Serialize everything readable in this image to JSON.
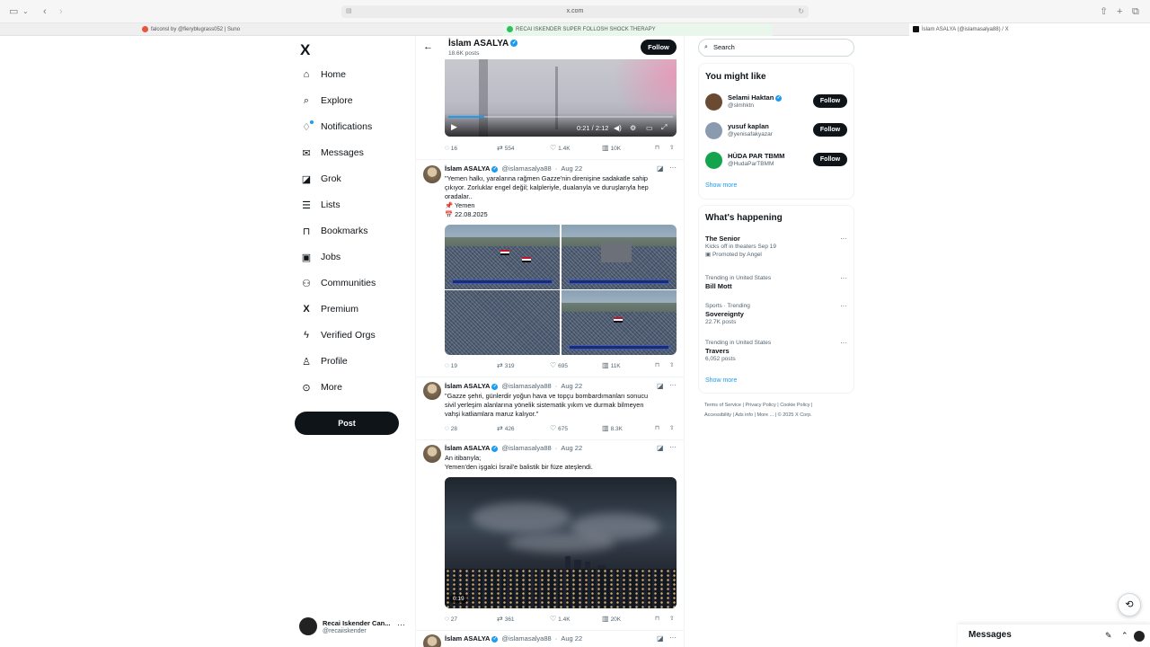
{
  "browser": {
    "url": "x.com",
    "tabs": [
      {
        "label": "falconsl by @fieryblugrass052 | Suno",
        "favicon_color": "#e8553a"
      },
      {
        "label": "RECAI ISKENDER SUPER FOLLOSH SHOCK THERAPY",
        "favicon_color": "#2ec05a"
      },
      {
        "label": "İslam ASALYA (@islamasalya88) / X",
        "favicon_color": "#111111"
      }
    ]
  },
  "nav": {
    "logo": "X",
    "items": [
      {
        "icon": "home-icon",
        "label": "Home"
      },
      {
        "icon": "search-icon",
        "label": "Explore"
      },
      {
        "icon": "bell-icon",
        "label": "Notifications"
      },
      {
        "icon": "mail-icon",
        "label": "Messages"
      },
      {
        "icon": "grok-icon",
        "label": "Grok"
      },
      {
        "icon": "list-icon",
        "label": "Lists"
      },
      {
        "icon": "bookmark-icon",
        "label": "Bookmarks"
      },
      {
        "icon": "briefcase-icon",
        "label": "Jobs"
      },
      {
        "icon": "people-icon",
        "label": "Communities"
      },
      {
        "icon": "x-icon",
        "label": "Premium"
      },
      {
        "icon": "lightning-icon",
        "label": "Verified Orgs"
      },
      {
        "icon": "person-icon",
        "label": "Profile"
      },
      {
        "icon": "more-circle-icon",
        "label": "More"
      }
    ],
    "post_label": "Post",
    "account": {
      "name": "Recai Iskender Can...",
      "handle": "@recaiiskender"
    }
  },
  "profile_header": {
    "name": "İslam ASALYA",
    "post_count": "18.6K posts",
    "follow_label": "Follow"
  },
  "video1": {
    "time": "0:21 / 2:12",
    "progress": 0.16,
    "actions": {
      "replies": "16",
      "reposts": "554",
      "likes": "1.4K",
      "views": "10K"
    }
  },
  "tweets": [
    {
      "name": "İslam ASALYA",
      "handle": "@islamasalya88",
      "date": "Aug 22",
      "text": "\"Yemen halkı, yaralarına rağmen Gazze'nin direnişine sadakatle sahip çıkıyor. Zorluklar engel değil; kalpleriyle, dualarıyla ve duruşlarıyla hep oradalar..",
      "line2": "📌 Yemen",
      "line3": "📅 22.08.2025",
      "actions": {
        "replies": "19",
        "reposts": "319",
        "likes": "695",
        "views": "11K"
      }
    },
    {
      "name": "İslam ASALYA",
      "handle": "@islamasalya88",
      "date": "Aug 22",
      "text": "\"Gazze şehri, günlerdir yoğun hava ve topçu bombardımanları sonucu sivil yerleşim alanlarına yönelik sistematik yıkım ve durmak bilmeyen vahşi katliamlara maruz kalıyor.\"",
      "actions": {
        "replies": "28",
        "reposts": "426",
        "likes": "675",
        "views": "8.3K"
      }
    },
    {
      "name": "İslam ASALYA",
      "handle": "@islamasalya88",
      "date": "Aug 22",
      "text": "An itibarıyla;",
      "line2": "Yemen'den işgalci İsrail'e balistik bir füze ateşlendi.",
      "video_duration": "0:19",
      "actions": {
        "replies": "27",
        "reposts": "361",
        "likes": "1.4K",
        "views": "20K"
      }
    },
    {
      "name": "İslam ASALYA",
      "handle": "@islamasalya88",
      "date": "Aug 22"
    }
  ],
  "search": {
    "placeholder": "Search"
  },
  "you_might_like": {
    "title": "You might like",
    "people": [
      {
        "name": "Selami Haktan",
        "handle": "@slmhktn",
        "verified": true,
        "avatar_color": "#6b4a33"
      },
      {
        "name": "yusuf kaplan",
        "handle": "@yenisafakyazar",
        "verified": false,
        "avatar_color": "#8a9bb0"
      },
      {
        "name": "HÜDA PAR TBMM",
        "handle": "@HudaParTBMM",
        "verified": false,
        "avatar_color": "#14a44d"
      }
    ],
    "follow_label": "Follow",
    "show_more": "Show more"
  },
  "whats_happening": {
    "title": "What's happening",
    "trends": [
      {
        "context": "",
        "name": "The Senior",
        "sub": "Kicks off in theaters Sep 19",
        "extra": "Promoted by Angel"
      },
      {
        "context": "Trending in United States",
        "name": "Bill Mott",
        "sub": "",
        "extra": ""
      },
      {
        "context": "Sports · Trending",
        "name": "Sovereignty",
        "sub": "22.7K posts",
        "extra": ""
      },
      {
        "context": "Trending in United States",
        "name": "Travers",
        "sub": "6,052 posts",
        "extra": ""
      }
    ],
    "show_more": "Show more"
  },
  "footer": {
    "links": [
      "Terms of Service",
      "Privacy Policy",
      "Cookie Policy",
      "Accessibility",
      "Ads info",
      "More ...",
      "© 2025 X Corp."
    ]
  },
  "messages_drawer": {
    "title": "Messages"
  },
  "colors": {
    "accent": "#1d9bf0",
    "text": "#0f1419",
    "muted": "#536471",
    "button": "#0f1419"
  }
}
